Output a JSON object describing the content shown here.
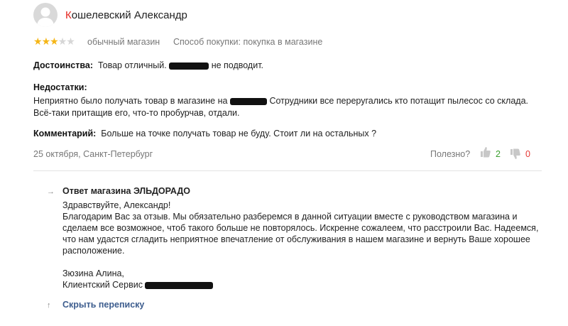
{
  "review": {
    "author_first_letter": "К",
    "author_rest": "ошелевский Александр",
    "rating": 3,
    "rating_max": 5,
    "shop_type": "обычный магазин",
    "purchase_method": "Способ покупки: покупка в магазине",
    "pros_label": "Достоинства:",
    "pros_text_before": "Товар отличный.",
    "pros_text_after": "не подводит.",
    "cons_label": "Недостатки:",
    "cons_text_before": "Неприятно было получать товар в магазине на",
    "cons_text_after": "Сотрудники все переругались кто потащит пылесос со склада. Всё-таки притащив его, что-то пробурчав, отдали.",
    "comment_label": "Комментарий:",
    "comment_text": "Больше на точке получать товар не буду. Стоит ли на остальных ?",
    "date_city": "25 октября, Санкт-Петербург",
    "useful_label": "Полезно?",
    "useful_yes": "2",
    "useful_no": "0"
  },
  "reply": {
    "title": "Ответ магазина ЭЛЬДОРАДО",
    "greeting": "Здравствуйте, Александр!",
    "body": "Благодарим Вас за отзыв. Мы обязательно разберемся в данной ситуации вместе с руководством магазина и сделаем все возможное, чтоб такого больше не повторялось. Искренне сожалеем, что расстроили Вас. Надеемся, что нам удастся сгладить неприятное впечатление от обслуживания в нашем магазине и вернуть Ваше хорошее расположение.",
    "signature_name": "Зюзина Алина,",
    "signature_service": "Клиентский Сервис",
    "hide_link": "Скрыть переписку"
  },
  "icons": [
    "avatar-placeholder-icon",
    "star-icon",
    "thumbs-up-icon",
    "thumbs-down-icon",
    "arrow-right-icon",
    "arrow-up-icon"
  ],
  "colors": {
    "star": "#f5b617",
    "yes": "#3a9f2e",
    "no": "#e53935",
    "link": "#3d5d8e",
    "name_initial": "#e52620"
  }
}
